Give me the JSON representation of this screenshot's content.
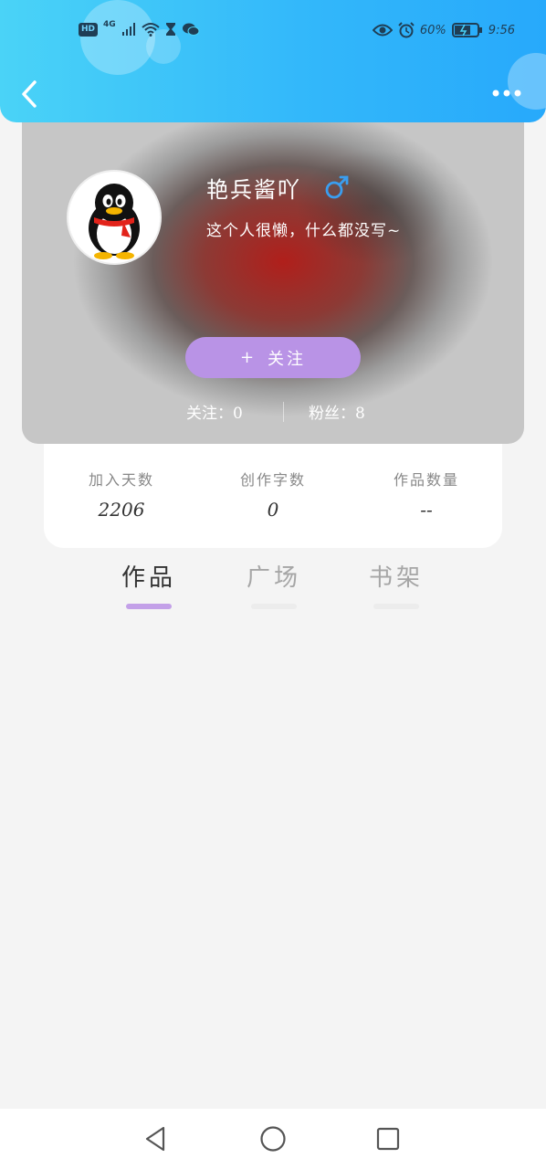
{
  "status_bar": {
    "hd": "HD",
    "network": "4G",
    "battery": "60%",
    "time": "9:56",
    "icons": [
      "signal-icon",
      "wifi-icon",
      "hourglass-icon",
      "wechat-icon",
      "eye-icon",
      "alarm-icon",
      "battery-icon"
    ]
  },
  "header": {
    "back_icon": "chevron-left-icon",
    "more_icon": "more-dots-icon"
  },
  "profile": {
    "username": "艳兵酱吖",
    "gender": "male",
    "bio": "这个人很懒，什么都没写~",
    "follow_button": {
      "icon": "+",
      "label": "关注"
    },
    "following_label": "关注：",
    "following_count": "0",
    "fans_label": "粉丝：",
    "fans_count": "8"
  },
  "stats": [
    {
      "label": "加入天数",
      "value": "2206"
    },
    {
      "label": "创作字数",
      "value": "0"
    },
    {
      "label": "作品数量",
      "value": "--"
    }
  ],
  "tabs": [
    {
      "label": "作品",
      "active": true
    },
    {
      "label": "广场",
      "active": false
    },
    {
      "label": "书架",
      "active": false
    }
  ],
  "colors": {
    "header_start": "#4ad3f7",
    "header_end": "#27a9fb",
    "follow_button": "#b993e6",
    "tab_indicator": "#c3a0e8",
    "gender_male": "#3a9ef0"
  },
  "nav": {
    "icons": [
      "back-triangle-icon",
      "home-circle-icon",
      "recent-square-icon"
    ]
  }
}
